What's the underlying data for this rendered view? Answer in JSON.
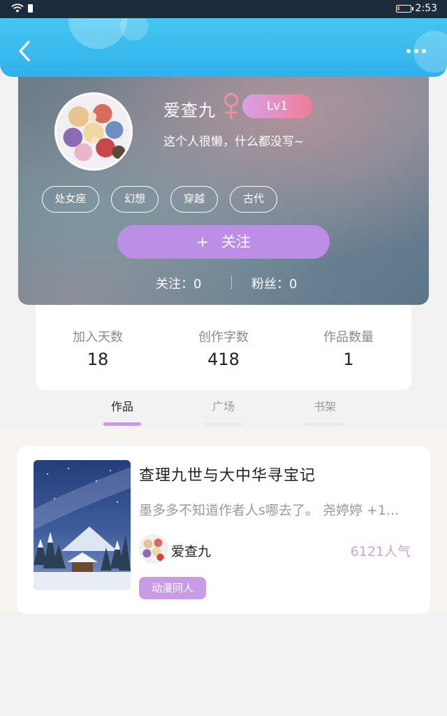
{
  "status_bar": {
    "time": "2:53",
    "battery_level": 0.18,
    "battery_color": "#ff7a1a"
  },
  "header": {
    "back_icon": "chevron-left-icon",
    "more_icon": "more-horizontal-icon",
    "accent": "#3bbaee"
  },
  "profile": {
    "nickname": "爱查九",
    "gender_icon": "female-icon",
    "level": "Lv1",
    "signature": "这个人很懒，什么都没写~",
    "tags": [
      "处女座",
      "幻想",
      "穿越",
      "古代"
    ],
    "follow_button": {
      "plus": "+",
      "label": "关注"
    },
    "following_text": "关注：0",
    "fans_text": "粉丝：0"
  },
  "stats": [
    {
      "label": "加入天数",
      "value": "18"
    },
    {
      "label": "创作字数",
      "value": "418"
    },
    {
      "label": "作品数量",
      "value": "1"
    }
  ],
  "tabs": [
    {
      "label": "作品",
      "active": true
    },
    {
      "label": "广场",
      "active": false
    },
    {
      "label": "书架",
      "active": false
    }
  ],
  "works": [
    {
      "title": "查理九世与大中华寻宝记",
      "description": "墨多多不知道作者人s哪去了。 尧婷婷 +1...",
      "author": "爱查九",
      "popularity": "6121人气",
      "genre": "动漫同人"
    }
  ],
  "colors": {
    "accent_purple": "#c79be6",
    "follow_button": "#bd8ee6",
    "level_gradient": [
      "#d8a2e6",
      "#f07d97"
    ],
    "popularity": "#cba4e8"
  }
}
